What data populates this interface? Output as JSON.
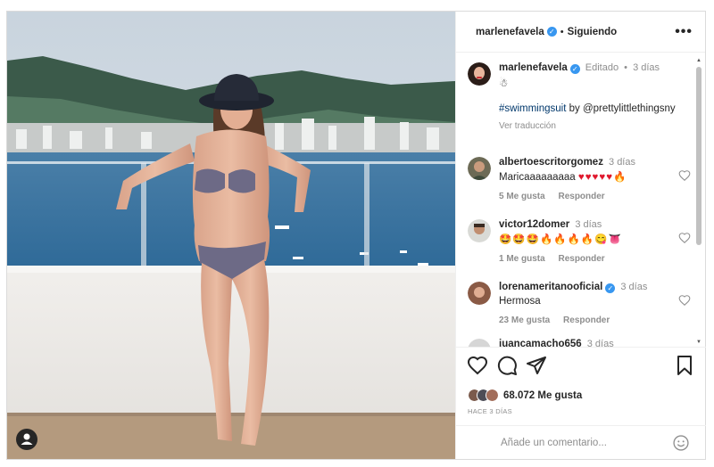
{
  "post": {
    "author": "marlenefavela",
    "follow_status": "Siguiendo",
    "more_icon": "more-options-icon"
  },
  "caption": {
    "author": "marlenefavela",
    "edited": "Editado",
    "time": "3 días",
    "emoji": "☃",
    "hashtag": "#swimmingsuit",
    "by": "by @prettylittlethingsny",
    "translate": "Ver traducción"
  },
  "comments": [
    {
      "user": "albertoescritorgomez",
      "time": "3 días",
      "text": "Maricaaaaaaaaa",
      "emojis": "♥♥♥♥♥🔥",
      "likes": "5 Me gusta",
      "reply": "Responder"
    },
    {
      "user": "victor12domer",
      "time": "3 días",
      "text": "",
      "emojis": "🤩🤩🤩🔥🔥🔥🔥😋👅",
      "likes": "1 Me gusta",
      "reply": "Responder"
    },
    {
      "user": "lorenameritanooficial",
      "time": "3 días",
      "text": "Hermosa",
      "emojis": "",
      "likes": "23 Me gusta",
      "reply": "Responder"
    },
    {
      "user": "juancamacho656",
      "time": "3 días",
      "text": "",
      "emojis": "",
      "likes": "",
      "reply": ""
    }
  ],
  "actions": {
    "likes": "68.072 Me gusta",
    "ago": "HACE 3 DÍAS"
  },
  "composer": {
    "placeholder": "Añade un comentario..."
  },
  "colors": {
    "verified": "#3897f0",
    "meta_text": "#8e8e8e",
    "link": "#00376b"
  }
}
